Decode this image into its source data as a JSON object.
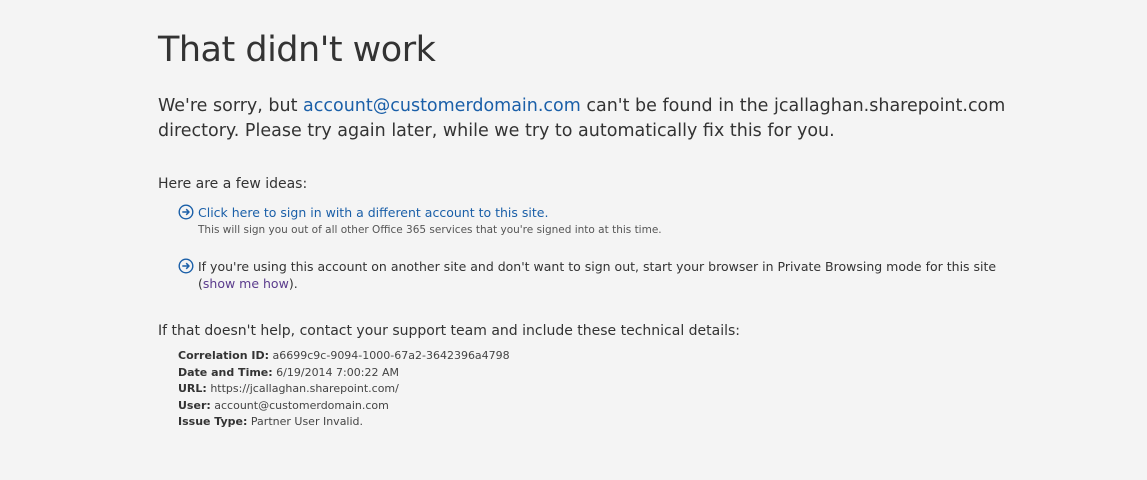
{
  "title": "That didn't work",
  "message": {
    "prefix": "We're sorry, but ",
    "account_link": "account@customerdomain.com",
    "suffix": " can't be found in the jcallaghan.sharepoint.com directory. Please try again later, while we try to automatically fix this for you."
  },
  "ideas": {
    "heading": "Here are a few ideas:",
    "items": [
      {
        "icon": "arrow-circle-right-icon",
        "link_text": "Click here to sign in with a different account to this site.",
        "sub_text": "This will sign you out of all other Office 365 services that you're signed into at this time."
      },
      {
        "icon": "arrow-circle-right-icon",
        "text": "If you're using this account on another site and don't want to sign out, start your browser in Private Browsing mode for this site (",
        "link_text": "show me how",
        "text_after": ")."
      }
    ]
  },
  "help": {
    "heading": "If that doesn't help, contact your support team and include these technical details:"
  },
  "details": [
    {
      "label": "Correlation ID:",
      "value": "a6699c9c-9094-1000-67a2-3642396a4798"
    },
    {
      "label": "Date and Time:",
      "value": "6/19/2014 7:00:22 AM"
    },
    {
      "label": "URL:",
      "value": "https://jcallaghan.sharepoint.com/"
    },
    {
      "label": "User:",
      "value": "account@customerdomain.com"
    },
    {
      "label": "Issue Type:",
      "value": "Partner User Invalid."
    }
  ],
  "colors": {
    "background": "#f4f4f4",
    "text": "#333333",
    "link": "#1a5fa8",
    "visited_link": "#5a3b8c"
  }
}
